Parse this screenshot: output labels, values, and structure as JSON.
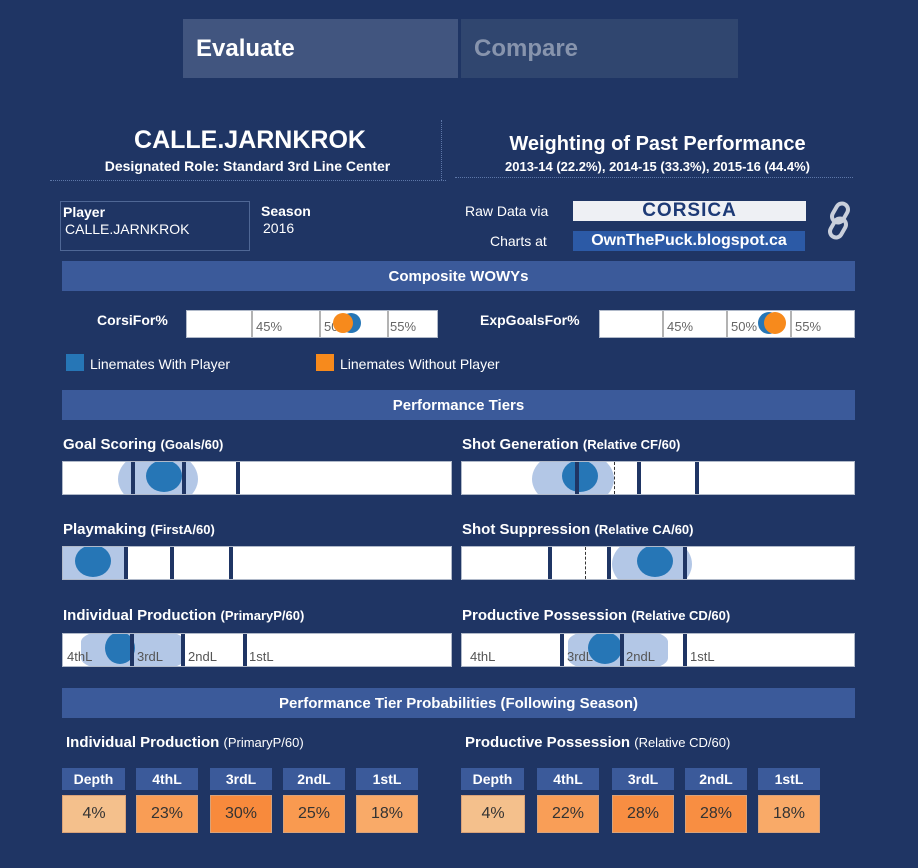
{
  "tabs": [
    {
      "label": "Evaluate",
      "active": true
    },
    {
      "label": "Compare",
      "active": false
    }
  ],
  "player_header": {
    "name": "CALLE.JARNKROK",
    "role": "Designated Role: Standard 3rd Line Center"
  },
  "weighting": {
    "title": "Weighting of Past Performance",
    "detail": "2013-14 (22.2%), 2014-15 (33.3%), 2015-16 (44.4%)"
  },
  "player_info": {
    "player_label": "Player",
    "player_value": "CALLE.JARNKROK",
    "season_label": "Season",
    "season_value": "2016"
  },
  "sources": {
    "raw_data_label": "Raw Data via",
    "raw_data_logo": "CORSICA",
    "charts_label": "Charts at",
    "charts_logo": "OwnThePuck.blogspot.ca",
    "link_icon": "chain-link-icon"
  },
  "composite": {
    "title": "Composite WOWYs",
    "corsi_label": "CorsiFor%",
    "xg_label": "ExpGoalsFor%",
    "ticks": [
      "45%",
      "50%",
      "55%"
    ],
    "legend_with": "Linemates With Player",
    "legend_without": "Linemates Without Player",
    "colors": {
      "with": "#2676b6",
      "without": "#f78a1c"
    }
  },
  "tiers": {
    "title": "Performance Tiers",
    "goal_scoring": {
      "title": "Goal Scoring",
      "sub": "(Goals/60)"
    },
    "shot_generation": {
      "title": "Shot Generation",
      "sub": "(Relative CF/60)"
    },
    "playmaking": {
      "title": "Playmaking",
      "sub": "(FirstA/60)"
    },
    "shot_suppression": {
      "title": "Shot Suppression",
      "sub": "(Relative CA/60)"
    },
    "individual_production": {
      "title": "Individual Production",
      "sub": "(PrimaryP/60)"
    },
    "productive_possession": {
      "title": "Productive Possession",
      "sub": "(Relative CD/60)"
    },
    "labels": [
      "4thL",
      "3rdL",
      "2ndL",
      "1stL"
    ]
  },
  "probabilities": {
    "title": "Performance Tier Probabilities (Following Season)",
    "left": {
      "title": "Individual Production",
      "sub": "(PrimaryP/60)",
      "headers": [
        "Depth",
        "4thL",
        "3rdL",
        "2ndL",
        "1stL"
      ],
      "values": [
        "4%",
        "23%",
        "30%",
        "25%",
        "18%"
      ],
      "colors": [
        "#f4c08c",
        "#f99d55",
        "#f88a3c",
        "#f99a50",
        "#f9aa68"
      ]
    },
    "right": {
      "title": "Productive Possession",
      "sub": "(Relative CD/60)",
      "headers": [
        "Depth",
        "4thL",
        "3rdL",
        "2ndL",
        "1stL"
      ],
      "values": [
        "4%",
        "22%",
        "28%",
        "28%",
        "18%"
      ],
      "colors": [
        "#f4c08c",
        "#f99e57",
        "#f88e42",
        "#f88e42",
        "#f9aa68"
      ]
    }
  }
}
